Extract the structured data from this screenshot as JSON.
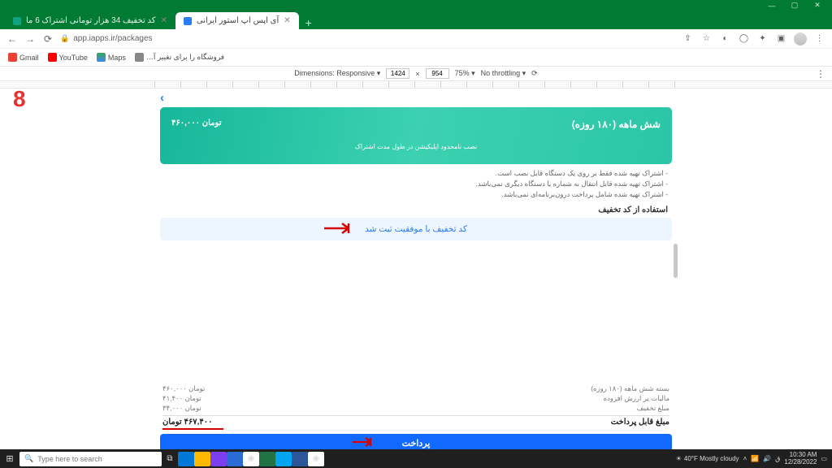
{
  "window": {
    "min": "—",
    "max": "▢",
    "close": "✕"
  },
  "tabs": {
    "inactive": {
      "title": "کد تخفیف 34 هزار تومانی اشتراک 6 ما"
    },
    "active": {
      "title": "آی اپس اپ استور ایرانی"
    }
  },
  "address": {
    "url": "app.iapps.ir/packages"
  },
  "bookmarks": {
    "gmail": "Gmail",
    "youtube": "YouTube",
    "maps": "Maps",
    "shop": "…فروشگاه را برای تغییر آ"
  },
  "devtools": {
    "dim": "Dimensions: Responsive ▾",
    "w": "1424",
    "h": "954",
    "x": "×",
    "zoom": "75% ▾",
    "thr": "No throttling ▾",
    "rot": "⟳"
  },
  "annot": {
    "step": "8"
  },
  "card": {
    "title": "شش ماهه (۱۸۰ روزه)",
    "price": "۴۶۰,۰۰۰ تومان",
    "sub": "نصب نامحدود اپلیکیشن در طول مدت اشتراک",
    "notes": [
      "- اشتراک تهیه شده فقط بر روی یک دستگاه قابل نصب است.",
      "- اشتراک تهیه شده قابل انتقال به شماره یا دستگاه دیگری نمی‌باشد.",
      "- اشتراک تهیه شده شامل پرداخت درون‌برنامه‌ای نمی‌باشد."
    ],
    "discount_label": "استفاده از کد تخفیف",
    "success": "کد تخفیف با موفقیت ثبت شد"
  },
  "summary": {
    "rows": [
      {
        "l": "بسته شش ماهه (۱۸۰ روزه)",
        "v": "۴۶۰,۰۰۰ تومان"
      },
      {
        "l": "مالیات بر ارزش افزوده",
        "v": "۴۱,۴۰۰ تومان"
      },
      {
        "l": "مبلغ تخفیف",
        "v": "۳۴,۰۰۰ تومان"
      }
    ],
    "total": {
      "l": "مبلغ قابل پرداخت",
      "v": "۴۶۷,۴۰۰ تومان"
    }
  },
  "pay": "پرداخت",
  "tray": {
    "wx": "40°F Mostly cloudy",
    "time": "10:30 AM",
    "date": "12/28/2022"
  },
  "search": {
    "ph": "Type here to search"
  }
}
